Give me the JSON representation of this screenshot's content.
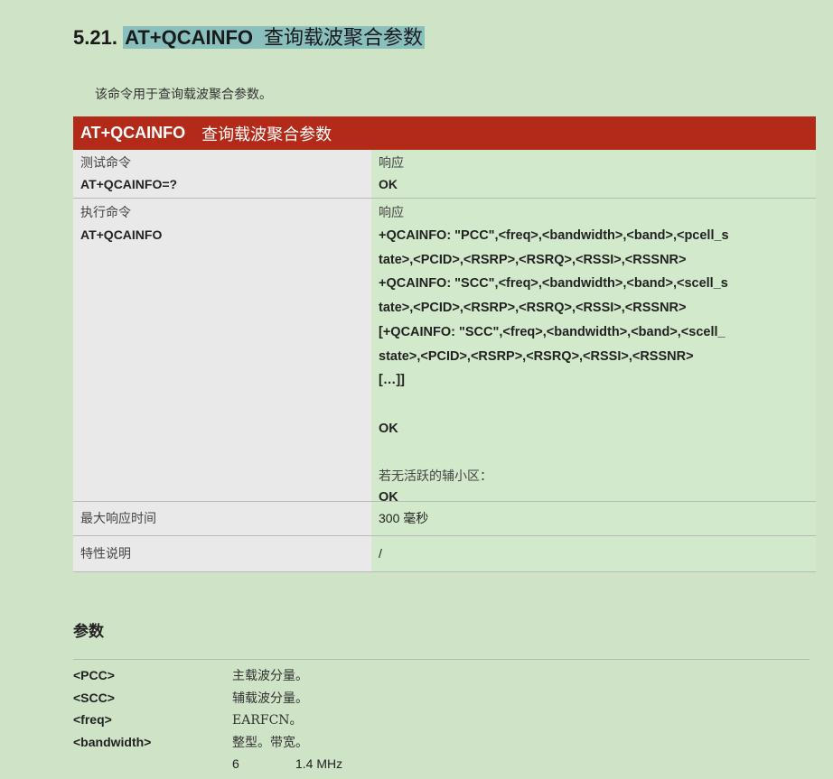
{
  "section": {
    "number": "5.21.",
    "command": "AT+QCAINFO",
    "title_cn": "查询载波聚合参数"
  },
  "intro": "该命令用于查询载波聚合参数。",
  "table": {
    "header_command": "AT+QCAINFO",
    "header_cn": "查询载波聚合参数",
    "test": {
      "label": "测试命令",
      "command": "AT+QCAINFO=?",
      "resp_label": "响应",
      "resp_value": "OK"
    },
    "exec": {
      "label": "执行命令",
      "command": "AT+QCAINFO",
      "resp_label": "响应",
      "lines": [
        "+QCAINFO: \"PCC\",<freq>,<bandwidth>,<band>,<pcell_s",
        "tate>,<PCID>,<RSRP>,<RSRQ>,<RSSI>,<RSSNR>",
        "+QCAINFO: \"SCC\",<freq>,<bandwidth>,<band>,<scell_s",
        "tate>,<PCID>,<RSRP>,<RSRQ>,<RSSI>,<RSSNR>",
        "[+QCAINFO: \"SCC\",<freq>,<bandwidth>,<band>,<scell_",
        "state>,<PCID>,<RSRP>,<RSRQ>,<RSSI>,<RSSNR>",
        "[…]]"
      ],
      "ok1": "OK",
      "no_scell": "若无活跃的辅小区：",
      "ok2": "OK"
    },
    "max_time": {
      "label": "最大响应时间",
      "value": "300 毫秒"
    },
    "note": {
      "label": "特性说明",
      "value": "/"
    }
  },
  "params": {
    "title": "参数",
    "items": [
      {
        "name": "<PCC>",
        "desc": "主载波分量。"
      },
      {
        "name": "<SCC>",
        "desc": "辅载波分量。"
      },
      {
        "name": "<freq>",
        "desc": "EARFCN。"
      },
      {
        "name": "<bandwidth>",
        "desc": "整型。带宽。"
      }
    ],
    "bandwidth_values": [
      {
        "value": "6",
        "desc": "1.4 MHz"
      }
    ]
  }
}
